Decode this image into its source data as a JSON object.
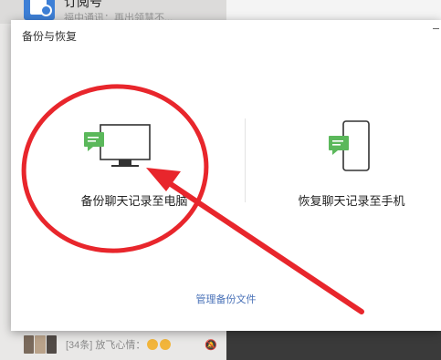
{
  "background": {
    "top_item": {
      "title": "订阅号",
      "preview": "福中通讯：再出领慧不..."
    },
    "bottom_item": {
      "preview": "[34条] 放飞心情："
    }
  },
  "dialog": {
    "title": "备份与恢复",
    "backup_option_label": "备份聊天记录至电脑",
    "restore_option_label": "恢复聊天记录至手机",
    "manage_link": "管理备份文件"
  },
  "colors": {
    "brand_green": "#5bb85b",
    "link_blue": "#4a72b8",
    "annotation_red": "#e8262c"
  }
}
